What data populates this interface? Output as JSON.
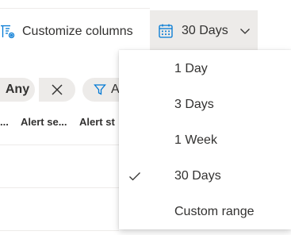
{
  "toolbar": {
    "customize_label": "Customize columns",
    "range_label": "30 Days"
  },
  "filters": {
    "any_label": "Any",
    "add_label": "A"
  },
  "columns": {
    "col0": "...",
    "col1": "Alert se...",
    "col2": "Alert st"
  },
  "menu": {
    "items": [
      {
        "label": "1 Day",
        "selected": false
      },
      {
        "label": "3 Days",
        "selected": false
      },
      {
        "label": "1 Week",
        "selected": false
      },
      {
        "label": "30 Days",
        "selected": true
      },
      {
        "label": "Custom range",
        "selected": false
      }
    ]
  },
  "colors": {
    "accent": "#0078d4",
    "text": "#323130",
    "pill_bg": "#edebe9"
  },
  "icons": {
    "customize": "customize-columns-icon",
    "calendar": "calendar-icon",
    "chevron": "chevron-down-icon",
    "close": "close-icon",
    "filter": "filter-icon",
    "check": "checkmark-icon"
  }
}
